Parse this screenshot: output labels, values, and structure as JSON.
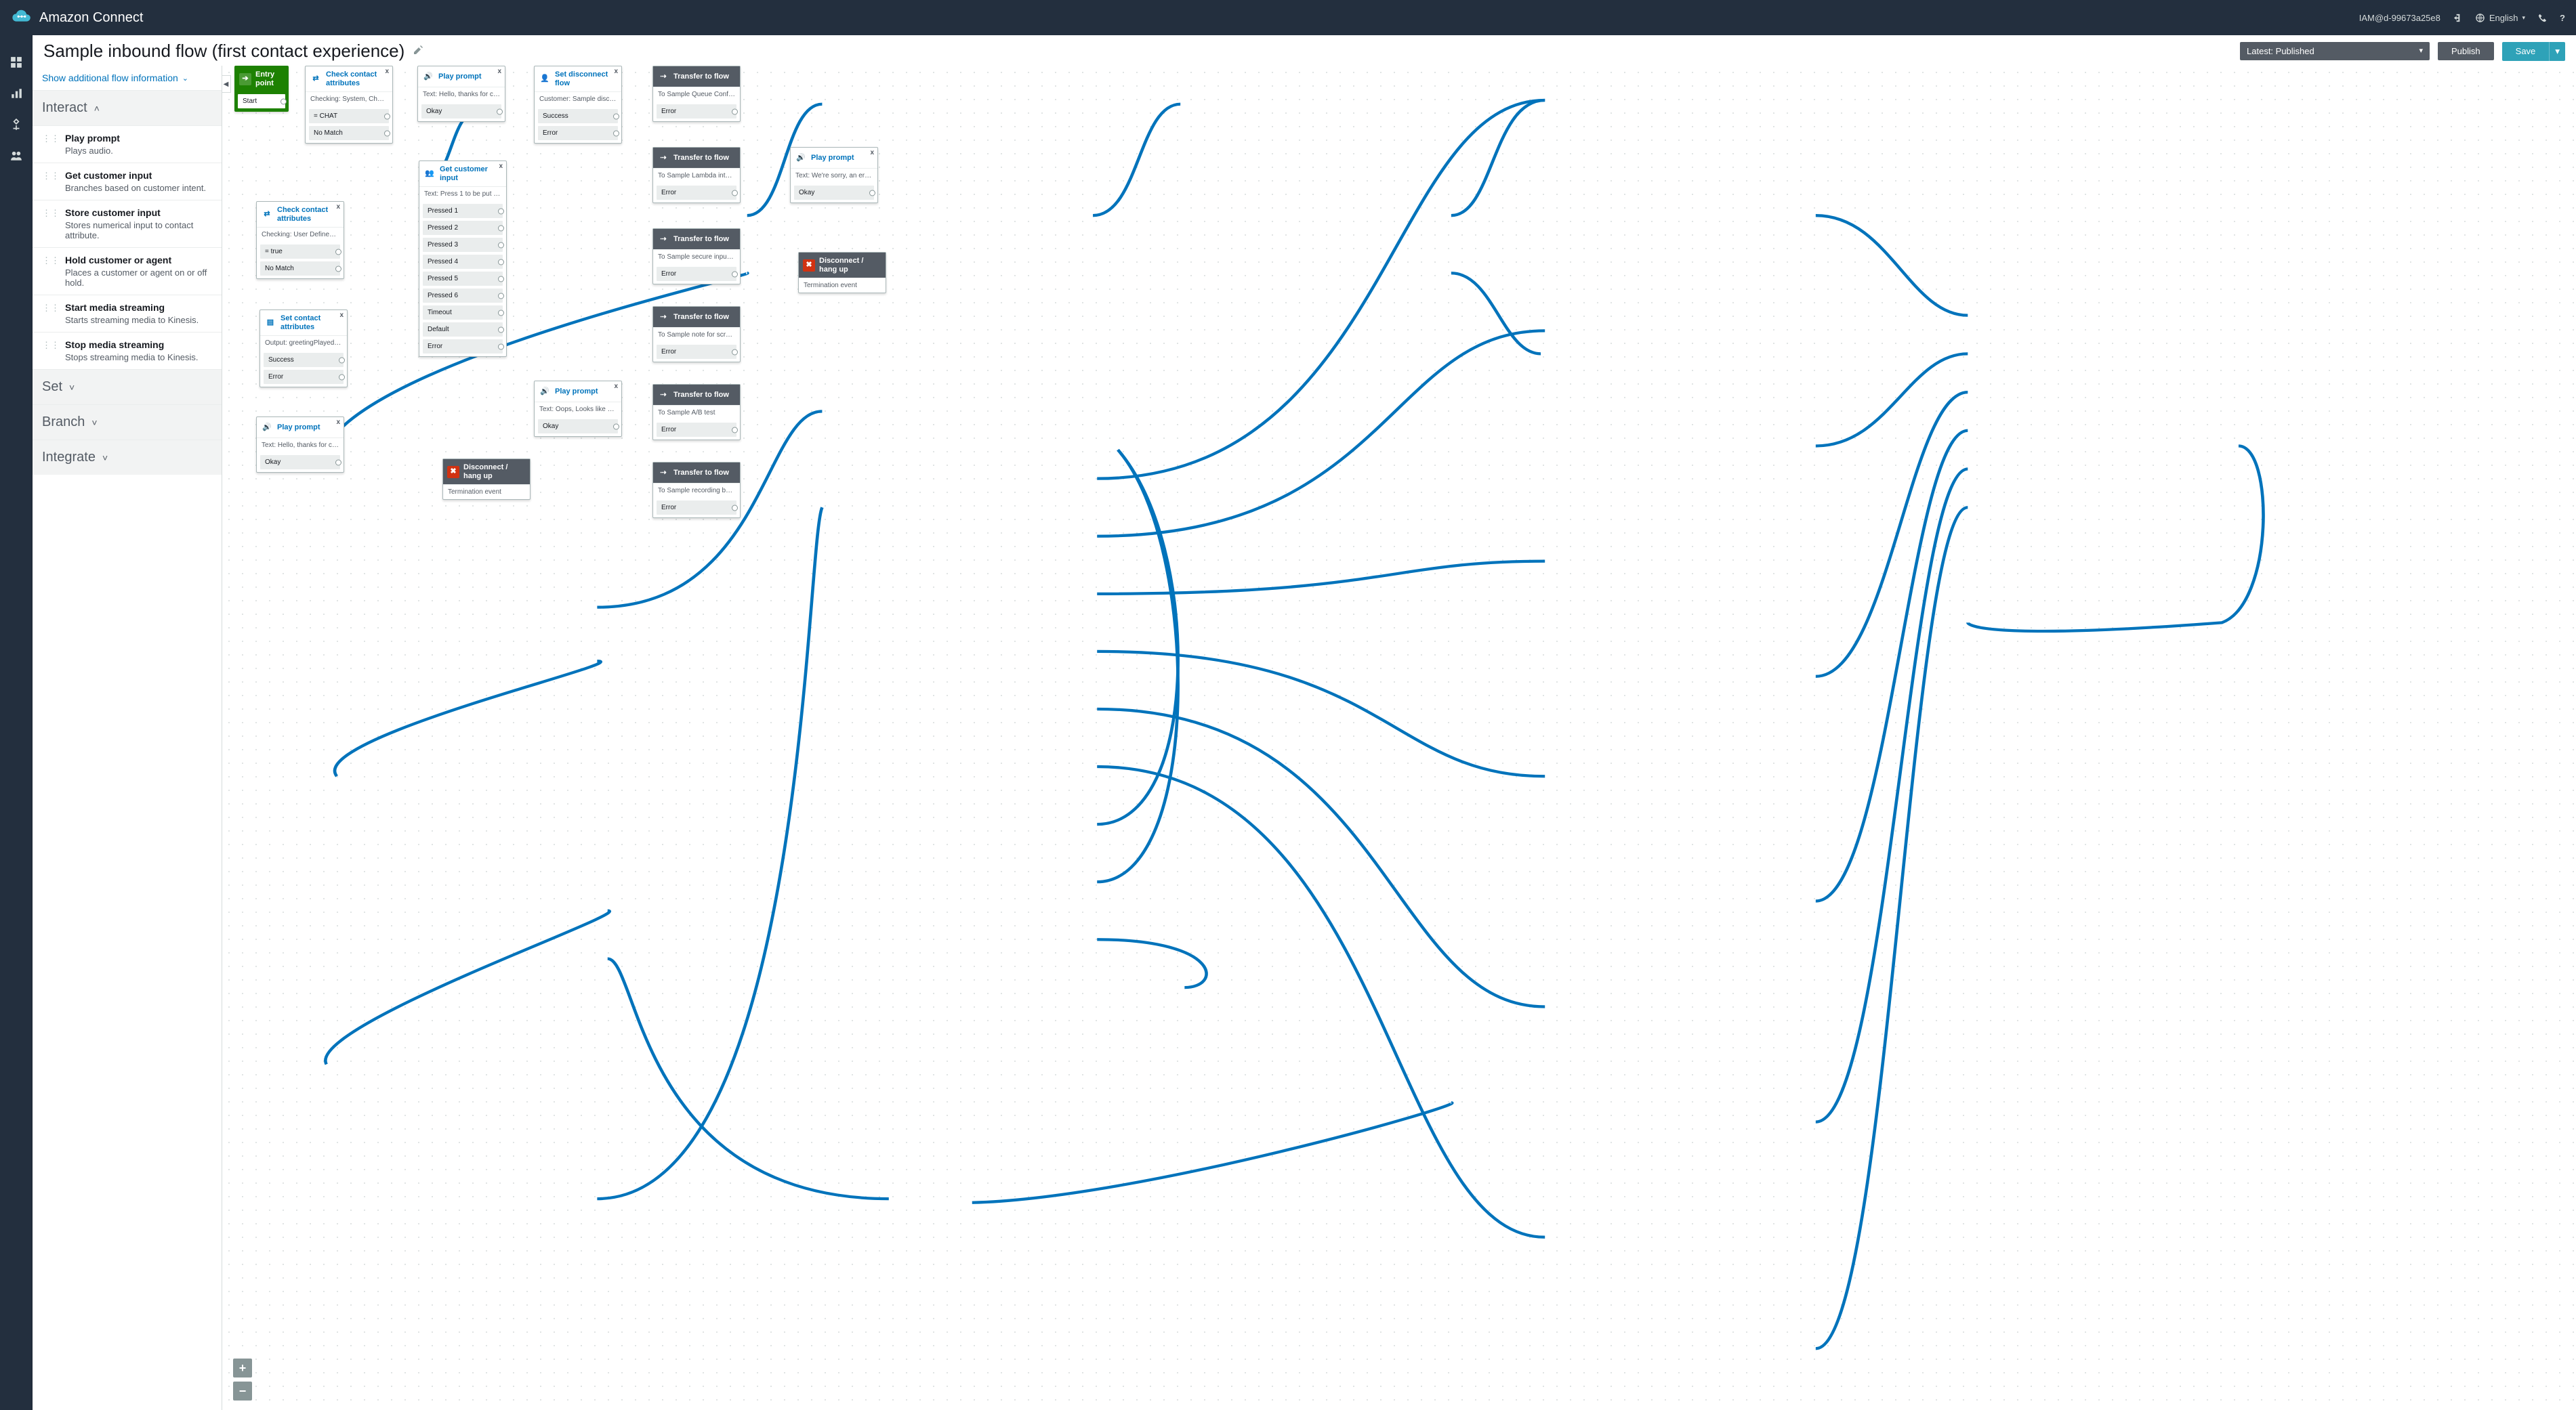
{
  "header": {
    "product": "Amazon Connect",
    "account": "IAM@d-99673a25e8",
    "language_label": "English"
  },
  "page": {
    "title": "Sample inbound flow (first contact experience)",
    "info_link": "Show additional flow information",
    "version_select": "Latest: Published",
    "publish_btn": "Publish",
    "save_btn": "Save"
  },
  "sidebar": {
    "sections": {
      "interact": {
        "label": "Interact",
        "open": true
      },
      "set": {
        "label": "Set",
        "open": false
      },
      "branch": {
        "label": "Branch",
        "open": false
      },
      "integrate": {
        "label": "Integrate",
        "open": false
      }
    },
    "interact_items": [
      {
        "title": "Play prompt",
        "desc": "Plays audio."
      },
      {
        "title": "Get customer input",
        "desc": "Branches based on customer intent."
      },
      {
        "title": "Store customer input",
        "desc": "Stores numerical input to contact attribute."
      },
      {
        "title": "Hold customer or agent",
        "desc": "Places a customer or agent on or off hold."
      },
      {
        "title": "Start media streaming",
        "desc": "Starts streaming media to Kinesis."
      },
      {
        "title": "Stop media streaming",
        "desc": "Stops streaming media to Kinesis."
      }
    ]
  },
  "nodes": {
    "entry": {
      "title": "Entry point",
      "branch0": "Start"
    },
    "check1": {
      "title": "Check contact attributes",
      "desc": "Checking: System, Channel",
      "b0": "= CHAT",
      "b1": "No Match"
    },
    "play1": {
      "title": "Play prompt",
      "desc": "Text: Hello, thanks for cont...",
      "b0": "Okay"
    },
    "disc1": {
      "title": "Set disconnect flow",
      "desc": "Customer: Sample disconn...",
      "b0": "Success",
      "b1": "Error"
    },
    "t1": {
      "title": "Transfer to flow",
      "desc": "To Sample Queue Configur...",
      "b0": "Error"
    },
    "t2": {
      "title": "Transfer to flow",
      "desc": "To Sample Lambda integra...",
      "b0": "Error"
    },
    "t3": {
      "title": "Transfer to flow",
      "desc": "To Sample secure input wit...",
      "b0": "Error"
    },
    "t4": {
      "title": "Transfer to flow",
      "desc": "To Sample note for screen...",
      "b0": "Error"
    },
    "t5": {
      "title": "Transfer to flow",
      "desc": "To Sample A/B test",
      "b0": "Error"
    },
    "t6": {
      "title": "Transfer to flow",
      "desc": "To Sample recording behav...",
      "b0": "Error"
    },
    "play2": {
      "title": "Play prompt",
      "desc": "Text: We're sorry, an error o...",
      "b0": "Okay"
    },
    "hang2": {
      "title": "Disconnect / hang up",
      "desc": "Termination event"
    },
    "check2": {
      "title": "Check contact attributes",
      "desc": "Checking: User Defined, gr...",
      "b0": "= true",
      "b1": "No Match"
    },
    "setattr": {
      "title": "Set contact attributes",
      "desc": "Output: greetingPlayed = tr...",
      "b0": "Success",
      "b1": "Error"
    },
    "play3": {
      "title": "Play prompt",
      "desc": "Text: Hello, thanks for calli...",
      "b0": "Okay"
    },
    "getinput": {
      "title": "Get customer input",
      "desc": "Text: Press 1 to be put in q...",
      "b0": "Pressed 1",
      "b1": "Pressed 2",
      "b2": "Pressed 3",
      "b3": "Pressed 4",
      "b4": "Pressed 5",
      "b5": "Pressed 6",
      "b6": "Timeout",
      "b7": "Default",
      "b8": "Error"
    },
    "play4": {
      "title": "Play prompt",
      "desc": "Text: Oops, Looks like an er...",
      "b0": "Okay"
    },
    "hang1": {
      "title": "Disconnect / hang up",
      "desc": "Termination event"
    }
  }
}
